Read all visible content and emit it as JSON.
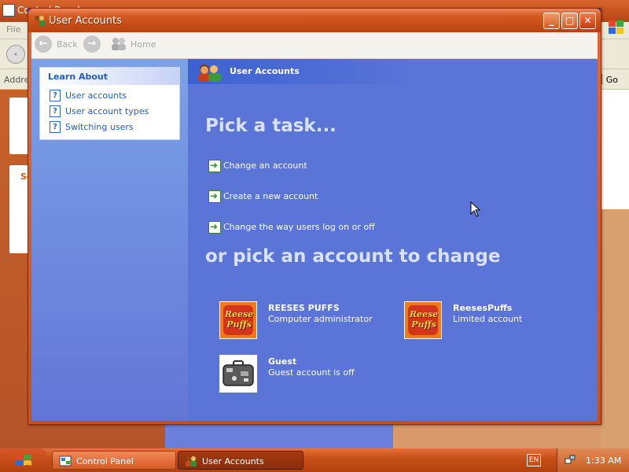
{
  "background_window": {
    "title": "Control Panel",
    "menu_file": "File",
    "address_label": "Address",
    "go_label": "Go",
    "section_label": "Se"
  },
  "window": {
    "title": "User Accounts",
    "buttons": {
      "minimize": "_",
      "maximize": "□",
      "close": "✕"
    }
  },
  "toolbar": {
    "back_label": "Back",
    "home_label": "Home"
  },
  "sidebar": {
    "learn_about_title": "Learn About",
    "items": [
      {
        "label": "User accounts"
      },
      {
        "label": "User account types"
      },
      {
        "label": "Switching users"
      }
    ]
  },
  "main": {
    "header_title": "User Accounts",
    "pick_task_heading": "Pick a task...",
    "tasks": [
      {
        "label": "Change an account"
      },
      {
        "label": "Create a new account"
      },
      {
        "label": "Change the way users log on or off"
      }
    ],
    "pick_account_heading": "or pick an account to change",
    "accounts": [
      {
        "name": "REESES PUFFS",
        "type": "Computer administrator",
        "picture_text": "Reese Puffs"
      },
      {
        "name": "ReesesPuffs",
        "type": "Limited account",
        "picture_text": "Reese Puffs"
      },
      {
        "name": "Guest",
        "type": "Guest account is off",
        "picture": "suitcase-icon"
      }
    ]
  },
  "taskbar": {
    "buttons": [
      {
        "label": "Control Panel"
      },
      {
        "label": "User Accounts"
      }
    ],
    "language": "EN",
    "clock": "1:33 AM"
  },
  "colors": {
    "titlebar": "#d45a22",
    "main_panel": "#5a74d8",
    "sidebar": "#7ba2e7",
    "heading_text": "#d9e2fb",
    "link_text": "#215dc6"
  }
}
